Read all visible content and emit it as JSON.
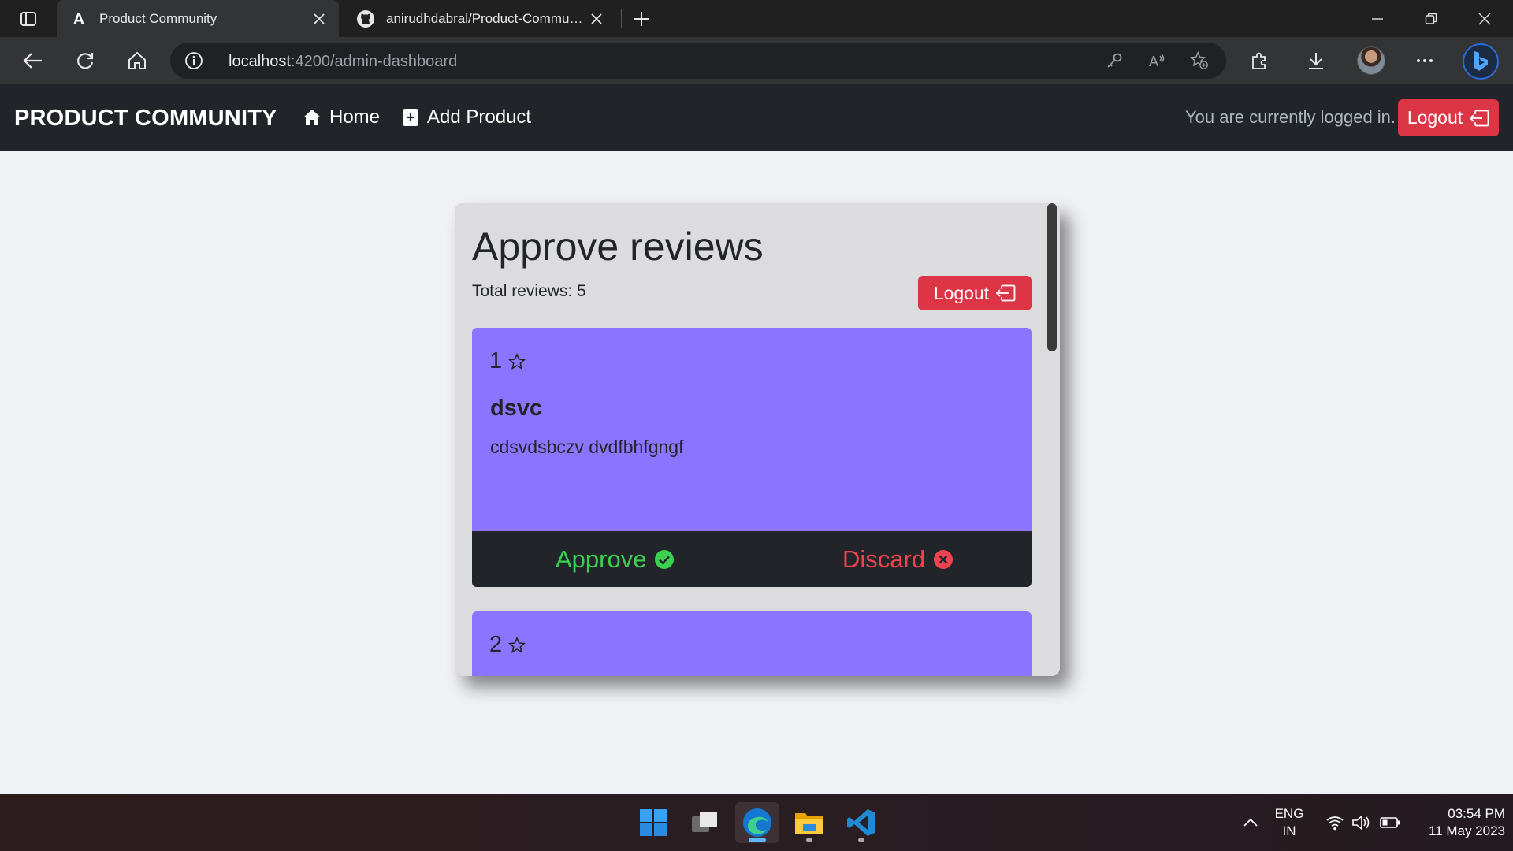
{
  "browser": {
    "tabs": [
      {
        "title": "Product Community",
        "active": true
      },
      {
        "title": "anirudhdabral/Product-Community",
        "active": false
      }
    ],
    "url_host": "localhost",
    "url_path": ":4200/admin-dashboard"
  },
  "app": {
    "brand": "PRODUCT COMMUNITY",
    "nav": {
      "home": "Home",
      "add_product": "Add Product"
    },
    "status_text": "You are currently logged in.",
    "logout_label": "Logout"
  },
  "panel": {
    "title": "Approve reviews",
    "total_label": "Total reviews: 5",
    "logout_label": "Logout"
  },
  "reviews": [
    {
      "rating": "1",
      "title": "dsvc",
      "body": "cdsvdsbczv dvdfbhfgngf",
      "approve_label": "Approve",
      "discard_label": "Discard"
    },
    {
      "rating": "2"
    }
  ],
  "taskbar": {
    "apps": [
      "start-icon",
      "task-view-icon",
      "edge-icon",
      "file-explorer-icon",
      "vscode-icon"
    ],
    "lang_line1": "ENG",
    "lang_line2": "IN",
    "time": "03:54 PM",
    "date": "11 May 2023"
  },
  "colors": {
    "app_nav_bg": "#212529",
    "danger": "#dc3545",
    "review_card": "#8b74ff",
    "approve": "#3bd04f",
    "discard": "#f0424f",
    "panel_bg": "#dcdbdd"
  }
}
